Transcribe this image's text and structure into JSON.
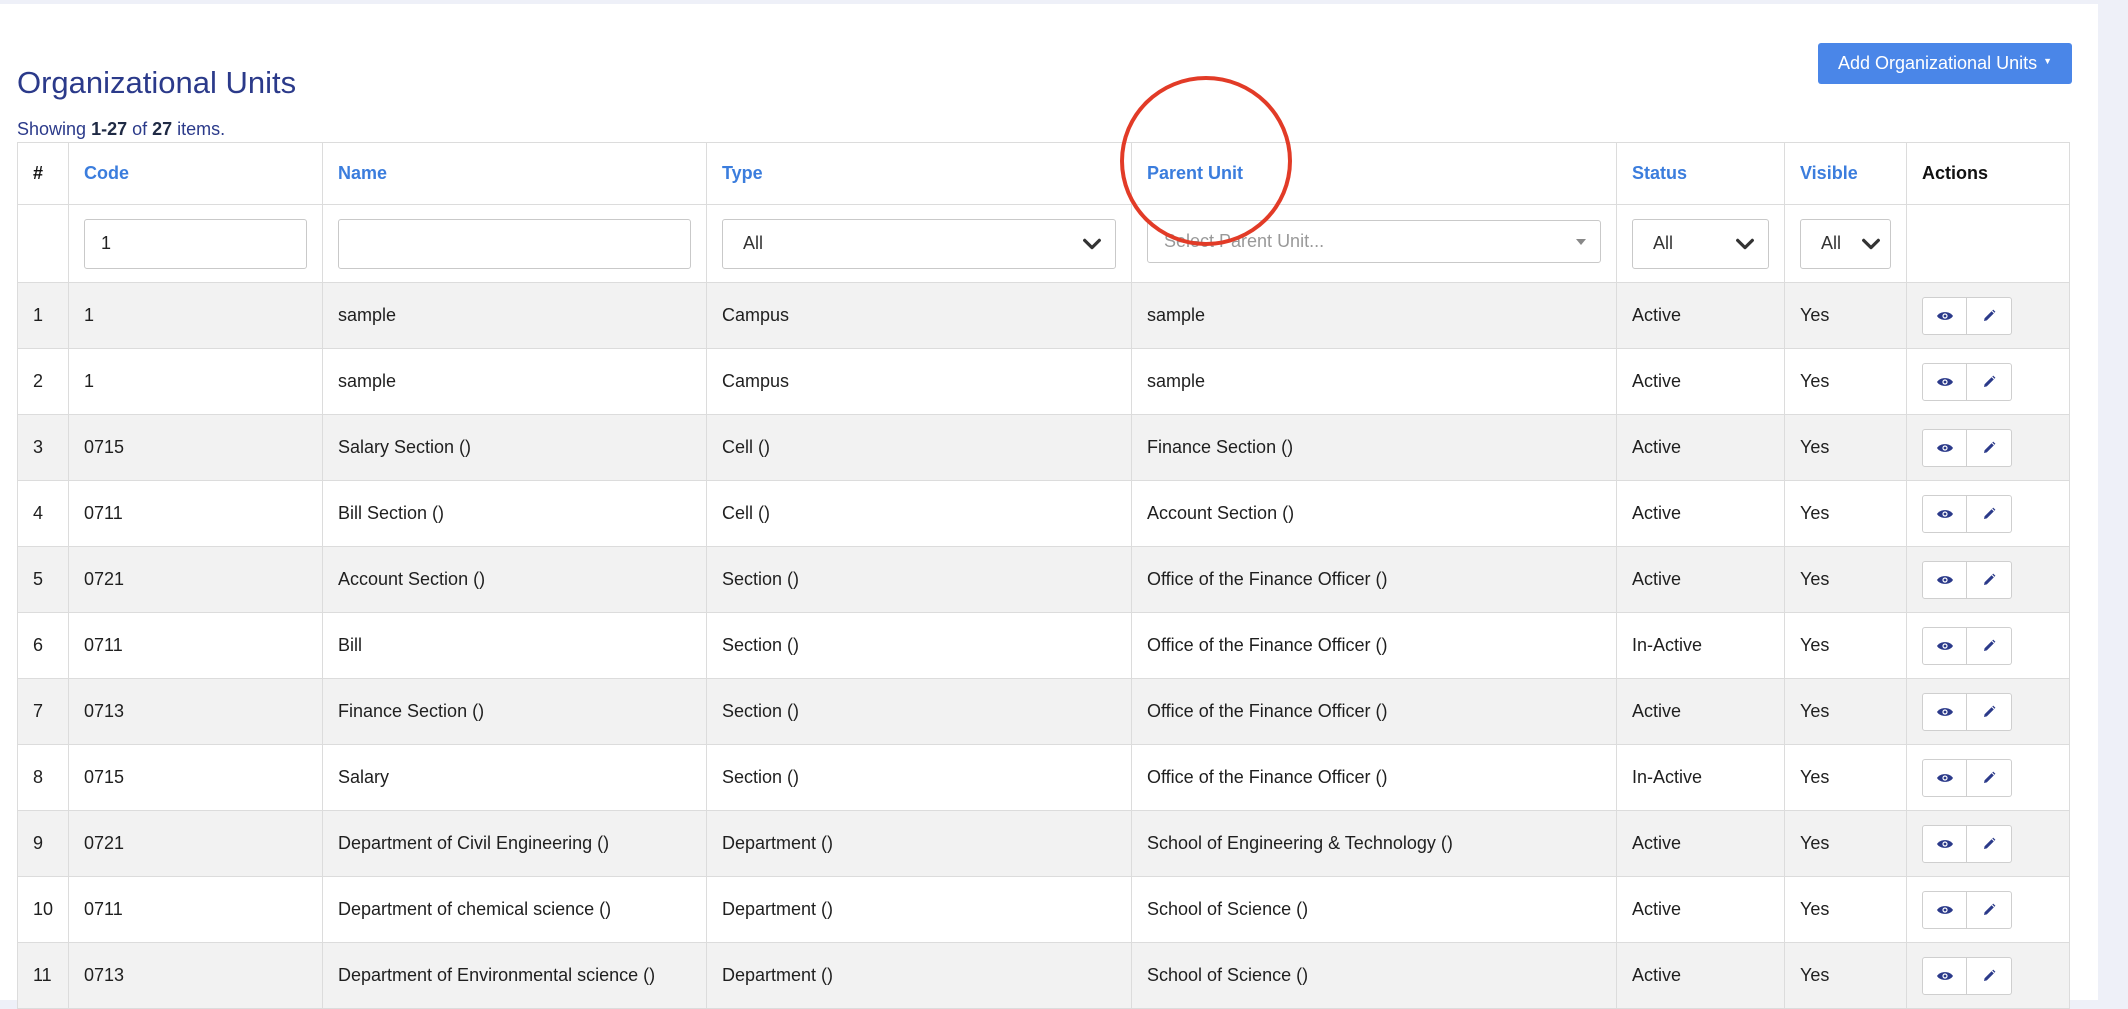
{
  "page": {
    "title": "Organizational Units"
  },
  "toolbar": {
    "add_label": "Add Organizational Units"
  },
  "summary": {
    "prefix": "Showing ",
    "range": "1-27",
    "of": " of ",
    "total": "27",
    "suffix": " items."
  },
  "columns": {
    "num": "#",
    "code": "Code",
    "name": "Name",
    "type": "Type",
    "parent": "Parent Unit",
    "status": "Status",
    "visible": "Visible",
    "actions": "Actions"
  },
  "filters": {
    "code_value": "1",
    "name_value": "",
    "type_value": "All",
    "parent_placeholder": "Select Parent Unit...",
    "status_value": "All",
    "visible_value": "All"
  },
  "rows": [
    {
      "num": "1",
      "code": "1",
      "name": "sample",
      "type": "Campus",
      "parent": "sample",
      "status": "Active",
      "visible": "Yes"
    },
    {
      "num": "2",
      "code": "1",
      "name": "sample",
      "type": "Campus",
      "parent": "sample",
      "status": "Active",
      "visible": "Yes"
    },
    {
      "num": "3",
      "code": "0715",
      "name": "Salary Section ()",
      "type": "Cell ()",
      "parent": "Finance Section ()",
      "status": "Active",
      "visible": "Yes"
    },
    {
      "num": "4",
      "code": "0711",
      "name": "Bill Section ()",
      "type": "Cell ()",
      "parent": "Account Section ()",
      "status": "Active",
      "visible": "Yes"
    },
    {
      "num": "5",
      "code": "0721",
      "name": "Account Section ()",
      "type": "Section ()",
      "parent": "Office of the Finance Officer ()",
      "status": "Active",
      "visible": "Yes"
    },
    {
      "num": "6",
      "code": "0711",
      "name": "Bill",
      "type": "Section ()",
      "parent": "Office of the Finance Officer ()",
      "status": "In-Active",
      "visible": "Yes"
    },
    {
      "num": "7",
      "code": "0713",
      "name": "Finance Section ()",
      "type": "Section ()",
      "parent": "Office of the Finance Officer ()",
      "status": "Active",
      "visible": "Yes"
    },
    {
      "num": "8",
      "code": "0715",
      "name": "Salary",
      "type": "Section ()",
      "parent": "Office of the Finance Officer ()",
      "status": "In-Active",
      "visible": "Yes"
    },
    {
      "num": "9",
      "code": "0721",
      "name": "Department of Civil Engineering ()",
      "type": "Department ()",
      "parent": "School of Engineering & Technology ()",
      "status": "Active",
      "visible": "Yes"
    },
    {
      "num": "10",
      "code": "0711",
      "name": "Department of chemical science ()",
      "type": "Department ()",
      "parent": "School of Science ()",
      "status": "Active",
      "visible": "Yes"
    },
    {
      "num": "11",
      "code": "0713",
      "name": "Department of Environmental science ()",
      "type": "Department ()",
      "parent": "School of Science ()",
      "status": "Active",
      "visible": "Yes"
    }
  ],
  "icons": {
    "view": "eye-icon",
    "edit": "pencil-icon"
  },
  "colors": {
    "accent": "#4a86e8",
    "title": "#2b3a8a",
    "link": "#3b7ddd",
    "annotation": "#e23b27"
  }
}
